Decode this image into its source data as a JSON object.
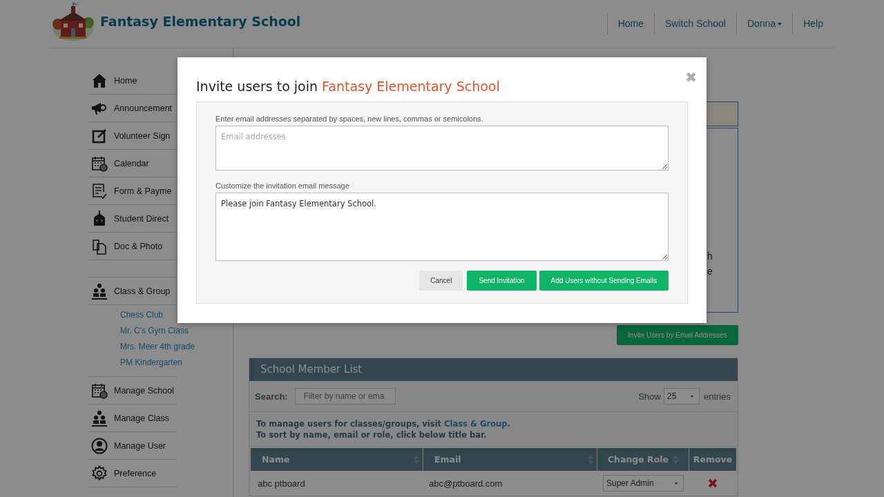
{
  "header": {
    "school_name": "Fantasy Elementary School",
    "nav": [
      {
        "label": "Home",
        "kind": "link"
      },
      {
        "label": "Switch School",
        "kind": "link"
      },
      {
        "label": "Donna",
        "kind": "dropdown"
      },
      {
        "label": "Help",
        "kind": "link"
      }
    ]
  },
  "sidebar": {
    "sections": [
      {
        "items": [
          {
            "label": "Home"
          },
          {
            "label": "Announcement"
          },
          {
            "label": "Volunteer Sign"
          },
          {
            "label": "Calendar"
          },
          {
            "label": "Form & Payme"
          },
          {
            "label": "Student Direct"
          },
          {
            "label": "Doc & Photo"
          }
        ]
      },
      {
        "items": [
          {
            "label": "Class & Group",
            "children": [
              {
                "label": "Chess Club"
              },
              {
                "label": "Mr. C's Gym Class"
              },
              {
                "label": "Mrs. Meer 4th grade"
              },
              {
                "label": "PM Kindergarten"
              }
            ]
          },
          {
            "label": "Manage School"
          },
          {
            "label": "Manage Class"
          },
          {
            "label": "Manage User"
          },
          {
            "label": "Preference"
          }
        ]
      }
    ]
  },
  "background_panel": {
    "text_fragments": [
      "h",
      "e"
    ]
  },
  "invite_button": "Invite Users by Email Addresses",
  "member_list": {
    "title": "School Member List",
    "search_label": "Search:",
    "search_placeholder": "Filter by name or ema",
    "show_label": "Show",
    "page_size": "25",
    "entries_label": "entries",
    "notice": [
      {
        "text": "To manage users for classes/groups, visit ",
        "link": "Class & Group",
        "after": "."
      },
      {
        "text": "To sort by name, email or role, click below title bar."
      }
    ],
    "columns": [
      {
        "label": "Name",
        "sortable": true
      },
      {
        "label": "Email",
        "sortable": true
      },
      {
        "label": "Change Role",
        "sortable": true
      },
      {
        "label": "Remove",
        "sortable": false
      }
    ],
    "rows": [
      {
        "name": "abc ptboard",
        "email": "abc@ptboard.com",
        "role": "Super Admin"
      }
    ]
  },
  "modal": {
    "title": "Invite users to join ",
    "title_highlight": "Fantasy Elementary School",
    "close": "✖",
    "email_label": "Enter email addresses separated by spaces, new lines, commas or semicolons.",
    "email_placeholder": "Email addresses",
    "message_label": "Customize the invitation email message",
    "message": "Please join Fantasy Elementary School.",
    "buttons": [
      {
        "label": "Cancel",
        "kind": "cancel"
      },
      {
        "label": "Send Invitation",
        "kind": "primary"
      },
      {
        "label": "Add Users without Sending Emails",
        "kind": "primary"
      }
    ]
  }
}
